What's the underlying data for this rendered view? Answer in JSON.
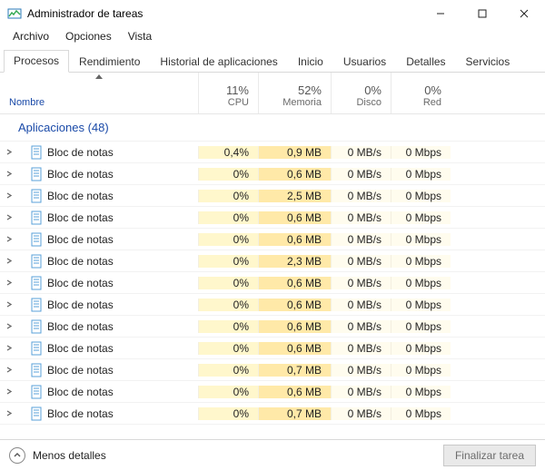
{
  "window": {
    "title": "Administrador de tareas"
  },
  "menu": {
    "items": [
      "Archivo",
      "Opciones",
      "Vista"
    ]
  },
  "tabs": {
    "items": [
      "Procesos",
      "Rendimiento",
      "Historial de aplicaciones",
      "Inicio",
      "Usuarios",
      "Detalles",
      "Servicios"
    ],
    "active_index": 0
  },
  "columns": {
    "name_label": "Nombre",
    "cols": [
      {
        "id": "cpu",
        "pct": "11%",
        "label": "CPU"
      },
      {
        "id": "mem",
        "pct": "52%",
        "label": "Memoria"
      },
      {
        "id": "disk",
        "pct": "0%",
        "label": "Disco"
      },
      {
        "id": "net",
        "pct": "0%",
        "label": "Red"
      }
    ]
  },
  "group": {
    "label": "Aplicaciones (48)"
  },
  "processes": [
    {
      "name": "Bloc de notas",
      "cpu": "0,4%",
      "mem": "0,9 MB",
      "disk": "0 MB/s",
      "net": "0 Mbps"
    },
    {
      "name": "Bloc de notas",
      "cpu": "0%",
      "mem": "0,6 MB",
      "disk": "0 MB/s",
      "net": "0 Mbps"
    },
    {
      "name": "Bloc de notas",
      "cpu": "0%",
      "mem": "2,5 MB",
      "disk": "0 MB/s",
      "net": "0 Mbps"
    },
    {
      "name": "Bloc de notas",
      "cpu": "0%",
      "mem": "0,6 MB",
      "disk": "0 MB/s",
      "net": "0 Mbps"
    },
    {
      "name": "Bloc de notas",
      "cpu": "0%",
      "mem": "0,6 MB",
      "disk": "0 MB/s",
      "net": "0 Mbps"
    },
    {
      "name": "Bloc de notas",
      "cpu": "0%",
      "mem": "2,3 MB",
      "disk": "0 MB/s",
      "net": "0 Mbps"
    },
    {
      "name": "Bloc de notas",
      "cpu": "0%",
      "mem": "0,6 MB",
      "disk": "0 MB/s",
      "net": "0 Mbps"
    },
    {
      "name": "Bloc de notas",
      "cpu": "0%",
      "mem": "0,6 MB",
      "disk": "0 MB/s",
      "net": "0 Mbps"
    },
    {
      "name": "Bloc de notas",
      "cpu": "0%",
      "mem": "0,6 MB",
      "disk": "0 MB/s",
      "net": "0 Mbps"
    },
    {
      "name": "Bloc de notas",
      "cpu": "0%",
      "mem": "0,6 MB",
      "disk": "0 MB/s",
      "net": "0 Mbps"
    },
    {
      "name": "Bloc de notas",
      "cpu": "0%",
      "mem": "0,7 MB",
      "disk": "0 MB/s",
      "net": "0 Mbps"
    },
    {
      "name": "Bloc de notas",
      "cpu": "0%",
      "mem": "0,6 MB",
      "disk": "0 MB/s",
      "net": "0 Mbps"
    },
    {
      "name": "Bloc de notas",
      "cpu": "0%",
      "mem": "0,7 MB",
      "disk": "0 MB/s",
      "net": "0 Mbps"
    }
  ],
  "footer": {
    "fewer_details": "Menos detalles",
    "end_task": "Finalizar tarea"
  },
  "icons": {
    "app": "task-manager-icon",
    "process": "notepad-icon"
  }
}
